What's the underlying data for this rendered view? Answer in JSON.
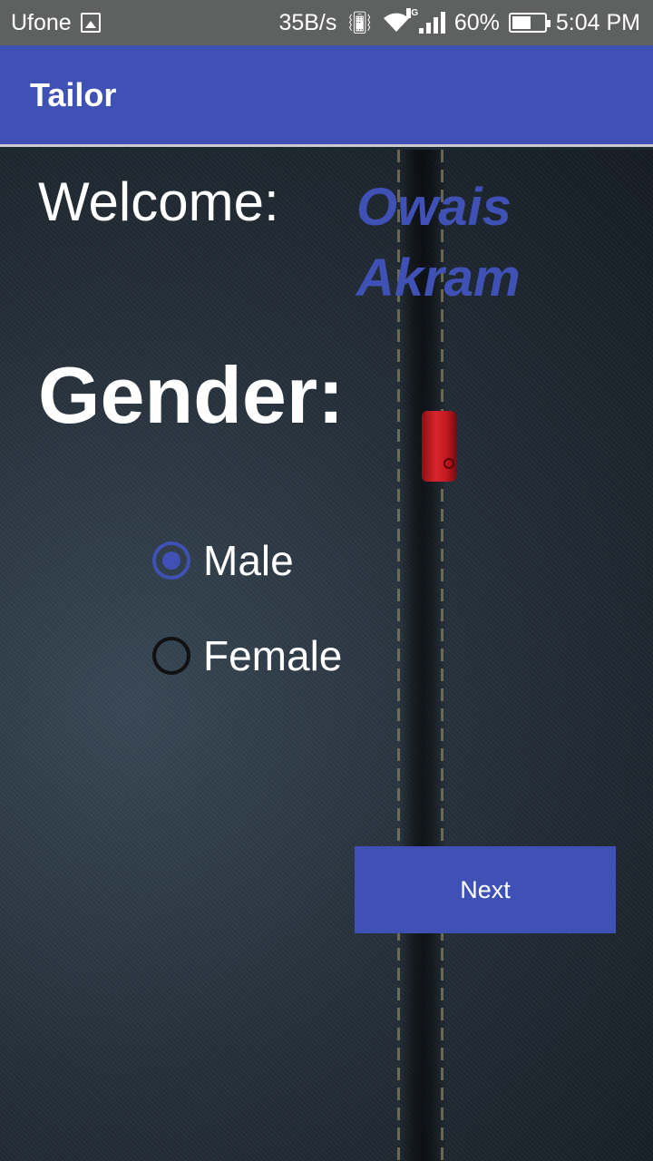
{
  "status_bar": {
    "carrier": "Ufone",
    "speed": "35B/s",
    "network_type": "3G",
    "battery": "60%",
    "battery_level": 0.6,
    "time": "5:04 PM"
  },
  "app_bar": {
    "title": "Tailor",
    "color": "#3f51b5"
  },
  "welcome": {
    "label": "Welcome:",
    "user_name": "Owais Akram"
  },
  "gender": {
    "label": "Gender:",
    "options": [
      {
        "label": "Male",
        "checked": true
      },
      {
        "label": "Female",
        "checked": false
      }
    ]
  },
  "actions": {
    "next_label": "Next"
  }
}
